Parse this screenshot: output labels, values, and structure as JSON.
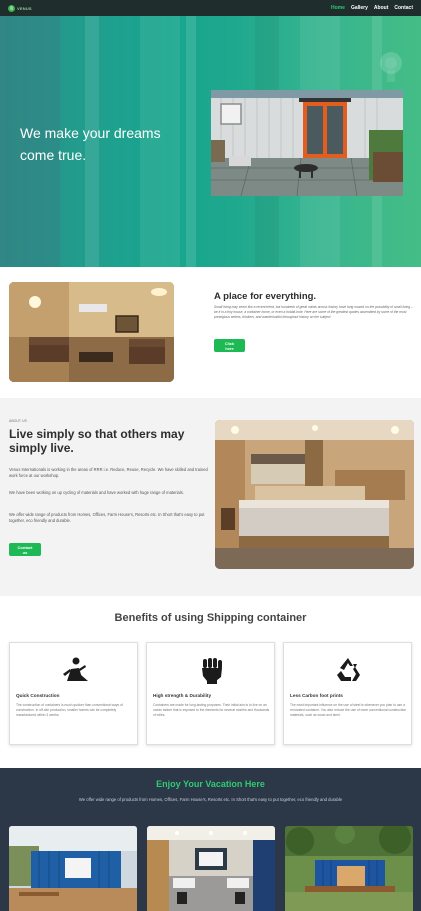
{
  "nav": {
    "logo_text": "VENUS",
    "links": [
      "Home",
      "Gallery",
      "About",
      "Contact"
    ],
    "active": "Home"
  },
  "hero": {
    "headline": "We make your dreams come true."
  },
  "place": {
    "title": "A place for everything.",
    "text": "Small living may seem like a recent trend, but hundreds of great minds across history have long mused on the possibility of small living – be it in a tiny house, a container home, or even a hobbit-hole. Here are some of the greatest quotes assembled by some of the most prestigious writers, thinkers, and wanderlustful throughout history on the subject.",
    "button": "Click here"
  },
  "about": {
    "kicker": "ABOUT US",
    "title": "Live simply so that others may simply live.",
    "paragraphs": [
      "Venus Internationals is working in the areas of RRR i.e. Reduce, Reuse, Recycle. We have skilled and trained work force at our workshop.",
      "We have been working on up cycling of materials and have worked with huge range of materials.",
      "We offer wide range of products from Homes, Offices, Farm House's, Resorts etc. In Short that's easy to put together, eco friendly and durable."
    ],
    "button": "Contact us"
  },
  "benefits": {
    "title": "Benefits of using Shipping container",
    "cards": [
      {
        "icon": "worker-icon",
        "title": "Quick Construction",
        "text": "The construction of containers is much quicker than conventional ways of construction. In off-site production, smaller homes can be completely manufactured within 3 weeks."
      },
      {
        "icon": "fist-icon",
        "title": "High strength & Durability",
        "text": "Containers are made for long-lasting purposes. Their initial aim is to live on an ocean tanker that is exposed to the elements for several months and thousands of miles."
      },
      {
        "icon": "recycle-icon",
        "title": "Less Carbon foot prints",
        "text": "The most important influence on the use of steel is whenever you plan to use a renovated container. You also reduce the use of more conventional construction materials, such as wood and steel."
      }
    ]
  },
  "vacation": {
    "title": "Enjoy Your Vacation Here",
    "subtitle": "We offer wide range of products from Homes, Offices, Farm House's, Resorts etc. In Short that's easy to put together, eco friendly and durable"
  },
  "colors": {
    "accent": "#1db954",
    "nav_bg": "#1f2d2c",
    "footer_bg": "#2c3748",
    "hero_teal": "#17a58e"
  }
}
